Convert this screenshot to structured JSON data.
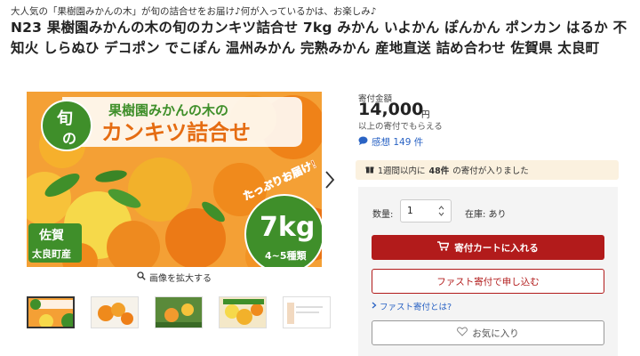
{
  "header": {
    "tagline": "大人気の「果樹園みかんの木」が旬の詰合せをお届け♪何が入っているかは、お楽しみ♪",
    "title": "N23 果樹園みかんの木の旬のカンキツ詰合せ 7kg みかん いよかん ぽんかん ポンカン はるか 不知火 しらぬひ デコポン でこぽん 温州みかん 完熟みかん 産地直送 詰め合わせ 佐賀県 太良町"
  },
  "gallery": {
    "banner_top": "果樹園みかんの木の",
    "banner_main": "カンキツ詰合せ",
    "badge_top": "旬",
    "badge_bottom": "の",
    "weight": "7kg",
    "variety_count": "4~5種類",
    "delivery_text": "たっぷりお届け!",
    "origin_line1": "佐賀",
    "origin_line2": "太良町産",
    "zoom_label": "画像を拡大する",
    "thumbnails": [
      {
        "label": "thumb-1"
      },
      {
        "label": "thumb-2"
      },
      {
        "label": "thumb-3"
      },
      {
        "label": "thumb-4"
      },
      {
        "label": "thumb-5"
      }
    ]
  },
  "donation": {
    "price_label": "寄付金額",
    "price": "14,000",
    "price_unit": "円",
    "price_note": "以上の寄付でもらえる",
    "reviews": "感想 149 件",
    "notice_prefix": "1週間以内に",
    "notice_count": "48件",
    "notice_suffix": "の寄付が入りました"
  },
  "purchase": {
    "qty_label": "数量:",
    "qty_value": "1",
    "stock_label": "在庫: あり",
    "cart_button": "寄付カートに入れる",
    "fast_button": "ファスト寄付で申し込む",
    "fast_link": "ファスト寄付とは?",
    "favorite_button": "お気に入り"
  },
  "colors": {
    "accent_red": "#b21b1b",
    "link_blue": "#2a63c4",
    "notice_bg": "#fbf1df",
    "panel_bg": "#f4f4f4",
    "orange": "#f29a2e",
    "green": "#3f8f2a"
  }
}
